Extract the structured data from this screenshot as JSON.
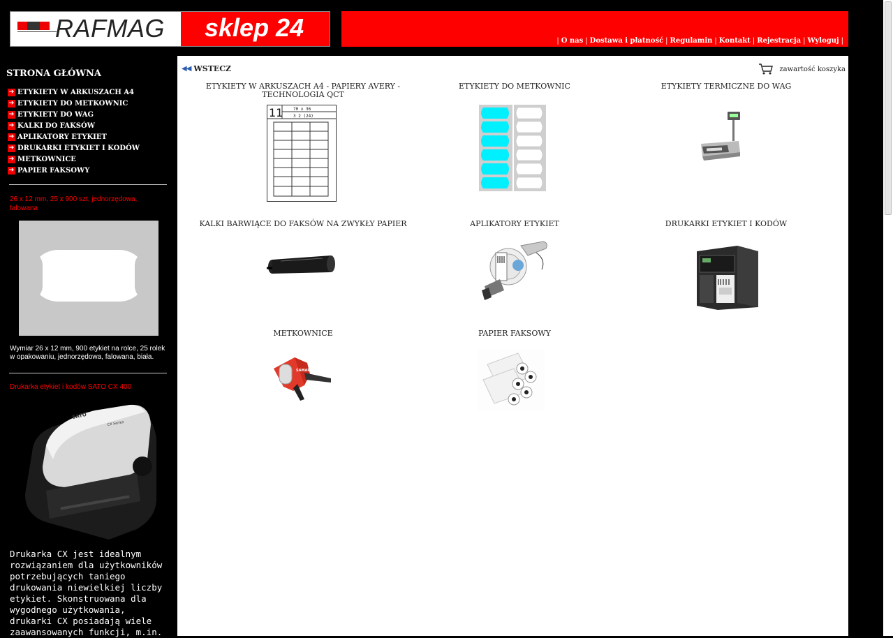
{
  "logo": {
    "brand": "RAFMAG",
    "shop": "sklep 24"
  },
  "topnav": [
    "O nas",
    "Dostawa i płatność",
    "Regulamin",
    "Kontakt",
    "Rejestracja",
    "Wyloguj"
  ],
  "sidebar": {
    "home": "STRONA GŁÓWNA",
    "categories": [
      "ETYKIETY W ARKUSZACH A4",
      "ETYKIETY DO METKOWNIC",
      "ETYKIETY DO WAG",
      "KALKI DO FAKSÓW",
      "APLIKATORY ETYKIET",
      "DRUKARKI ETYKIET I KODÓW",
      "METKOWNICE",
      "PAPIER FAKSOWY"
    ],
    "promo1": {
      "title": "26 x 12 mm, 25 x 900 szt, jednorzędowa, falowana",
      "desc": "Wymiar 26 x 12 mm, 900 etykiet na rolce, 25 rolek w opakowaniu, jednorzędowa, falowana, biała."
    },
    "promo2": {
      "title": "Drukarka etykiet i kodów SATO CX 400",
      "printer_brand": "SATO",
      "printer_series": "CX Series",
      "desc": "Drukarka CX jest idealnym rozwiązaniem dla użytkowników potrzebujących taniego drukowania niewielkiej liczby etykiet. Skonstruowana dla wygodnego użytkowania, drukarki CX posiadają wiele zaawansowanych funkcji, m.in."
    }
  },
  "main": {
    "back": "WSTECZ",
    "cart": "zawartość koszyka",
    "sheet_number": "11",
    "sheet_size1": "70 x 36",
    "sheet_size2": "3 2 (24)",
    "tiles": [
      "ETYKIETY W ARKUSZACH A4 - PAPIERY AVERY - TECHNOLOGIA QCT",
      "ETYKIETY DO METKOWNIC",
      "ETYKIETY TERMICZNE DO WAG",
      "KALKI BARWIĄCE DO FAKSÓW NA ZWYKŁY PAPIER",
      "APLIKATORY ETYKIET",
      "DRUKARKI ETYKIET I KODÓW",
      "METKOWNICE",
      "PAPIER FAKSOWY"
    ],
    "pricer_brand": "SAMARK"
  }
}
